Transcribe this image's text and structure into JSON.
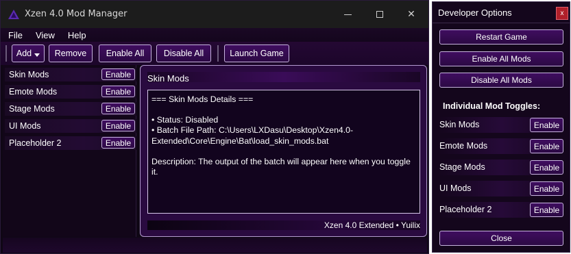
{
  "main_window": {
    "title": "Xzen 4.0 Mod Manager",
    "controls": {
      "minimize": "–",
      "maximize": "☐",
      "close": "✕"
    }
  },
  "menu": [
    "File",
    "View",
    "Help"
  ],
  "toolbar": {
    "add_label": "Add",
    "remove_label": "Remove",
    "enable_all_label": "Enable All",
    "disable_all_label": "Disable All",
    "launch_label": "Launch Game"
  },
  "mods": [
    {
      "label": "Skin Mods",
      "action": "Enable"
    },
    {
      "label": "Emote Mods",
      "action": "Enable"
    },
    {
      "label": "Stage Mods",
      "action": "Enable"
    },
    {
      "label": "UI Mods",
      "action": "Enable"
    },
    {
      "label": "Placeholder 2",
      "action": "Enable"
    }
  ],
  "details": {
    "header": "Skin Mods",
    "heading_line": "=== Skin Mods Details ===",
    "status_line": "• Status: Disabled",
    "batch_line_1": "• Batch File Path: C:\\Users\\LXDasu\\Desktop\\Xzen4.0-",
    "batch_line_2": "Extended\\Core\\Engine\\Bat\\load_skin_mods.bat",
    "description_line": "Description: The output of the batch will appear here when you toggle it.",
    "footer": "Xzen 4.0 Extended  •  Yuilix"
  },
  "developer": {
    "title": "Developer Options",
    "close_label": "x",
    "restart_label": "Restart Game",
    "enable_all_label": "Enable All Mods",
    "disable_all_label": "Disable All Mods",
    "section_title": "Individual Mod Toggles:",
    "toggles": [
      {
        "label": "Skin Mods",
        "action": "Enable"
      },
      {
        "label": "Emote Mods",
        "action": "Enable"
      },
      {
        "label": "Stage Mods",
        "action": "Enable"
      },
      {
        "label": "UI Mods",
        "action": "Enable"
      },
      {
        "label": "Placeholder 2",
        "action": "Enable"
      }
    ],
    "bottom_close_label": "Close"
  },
  "colors": {
    "button_fill": "#3f0d5f",
    "button_border": "#c8b4e0",
    "card_fill": "#2a0a40",
    "close_red": "#b0202a"
  },
  "icons": [
    "app-logo-icon",
    "chevron-down-icon"
  ]
}
